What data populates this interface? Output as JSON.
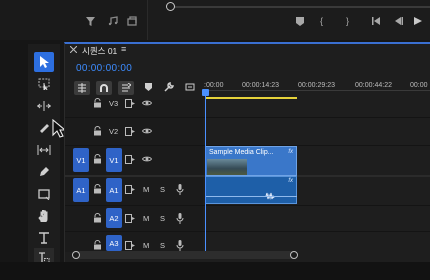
{
  "sequence": {
    "tab_label": "시퀀스 01",
    "menu_glyph": "≡",
    "timecode": "00:00:00:00"
  },
  "ruler": {
    "labels": [
      ":00:00",
      "00:00:14:23",
      "00:00:29:23",
      "00:00:44:22",
      "00:00"
    ]
  },
  "tracks": {
    "video": [
      {
        "name": "V3",
        "target": ""
      },
      {
        "name": "V2",
        "target": ""
      },
      {
        "name": "V1",
        "target": "V1"
      }
    ],
    "audio": [
      {
        "name": "A1",
        "target": "A1",
        "m": "M",
        "s": "S"
      },
      {
        "name": "A2",
        "target": "",
        "m": "M",
        "s": "S"
      },
      {
        "name": "A3",
        "target": "",
        "m": "M",
        "s": "S"
      }
    ]
  },
  "clip": {
    "name": "Sample Media Clip...",
    "fx": "fx"
  },
  "colors": {
    "accent": "#3d8cff",
    "track_target": "#2f63c7",
    "video_clip": "#3a77c9",
    "audio_clip": "#1e5fa8",
    "work_area_bar": "#e6d33a"
  },
  "tools": [
    "selection-icon",
    "track-select-icon",
    "ripple-edit-icon",
    "razor-icon",
    "slip-icon",
    "pen-icon",
    "rectangle-icon",
    "hand-icon",
    "type-icon",
    "captions-icon"
  ]
}
